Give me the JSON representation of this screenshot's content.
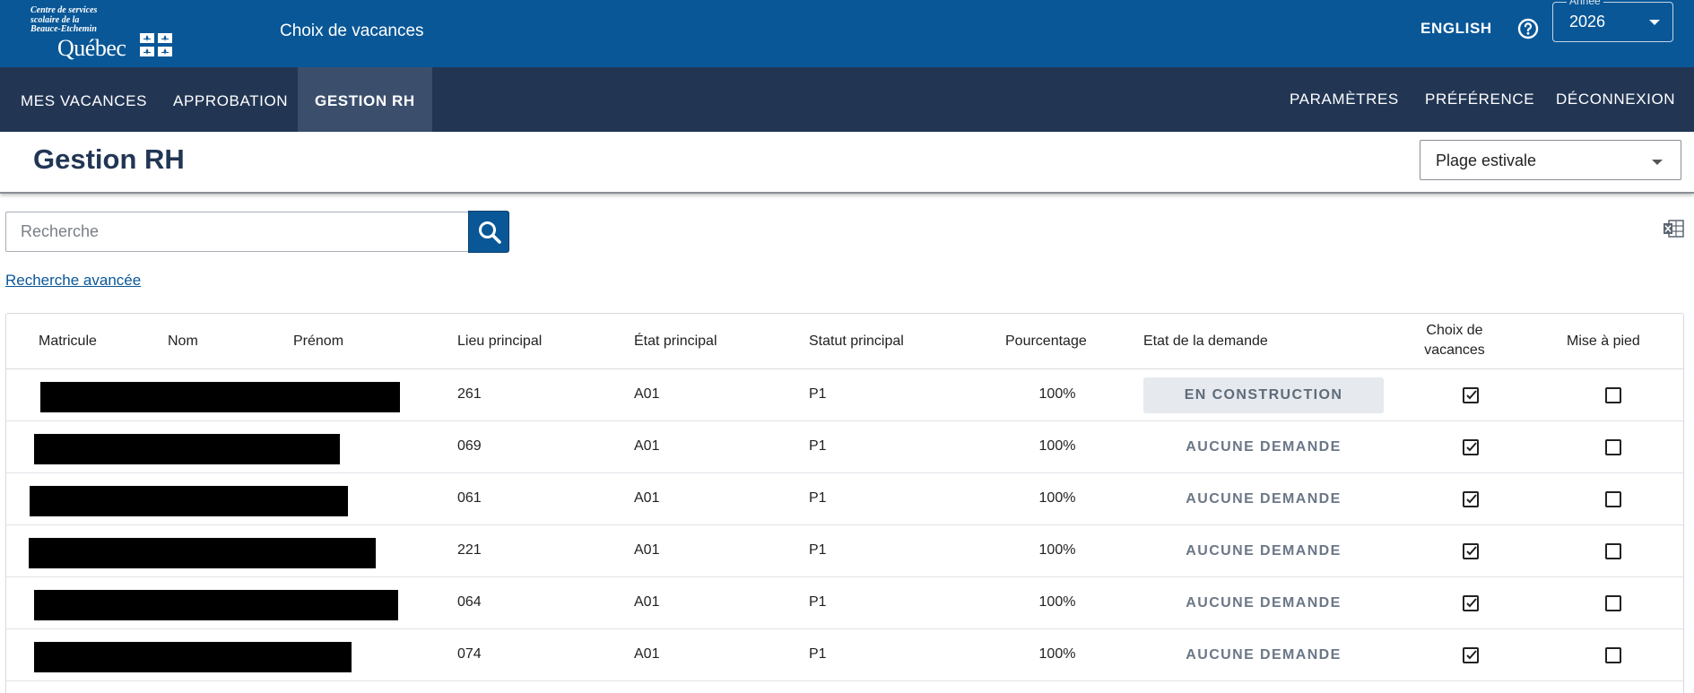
{
  "header": {
    "logo_lines": [
      "Centre de services",
      "scolaire de la",
      "Beauce-Etchemin"
    ],
    "logo_wordmark": "Québec",
    "app_title": "Choix de vacances",
    "language_link": "ENGLISH",
    "year_label": "Année",
    "year_value": "2026"
  },
  "nav": {
    "left": [
      "MES VACANCES",
      "APPROBATION",
      "GESTION RH"
    ],
    "active": "GESTION RH",
    "right": [
      "PARAMÈTRES",
      "PRÉFÉRENCE",
      "DÉCONNEXION"
    ]
  },
  "page": {
    "title": "Gestion RH",
    "period_value": "Plage estivale"
  },
  "search": {
    "placeholder": "Recherche",
    "advanced_link": "Recherche avancée"
  },
  "table": {
    "columns": [
      "Matricule",
      "Nom",
      "Prénom",
      "Lieu principal",
      "État principal",
      "Statut principal",
      "Pourcentage",
      "Etat de la demande",
      "Choix de vacances",
      "Mise à pied"
    ],
    "rows": [
      {
        "lieu": "261",
        "etat": "A01",
        "statut": "P1",
        "pourcentage": "100%",
        "demande": "EN CONSTRUCTION",
        "choix": true,
        "mise_a_pied": false
      },
      {
        "lieu": "069",
        "etat": "A01",
        "statut": "P1",
        "pourcentage": "100%",
        "demande": "AUCUNE DEMANDE",
        "choix": true,
        "mise_a_pied": false
      },
      {
        "lieu": "061",
        "etat": "A01",
        "statut": "P1",
        "pourcentage": "100%",
        "demande": "AUCUNE DEMANDE",
        "choix": true,
        "mise_a_pied": false
      },
      {
        "lieu": "221",
        "etat": "A01",
        "statut": "P1",
        "pourcentage": "100%",
        "demande": "AUCUNE DEMANDE",
        "choix": true,
        "mise_a_pied": false
      },
      {
        "lieu": "064",
        "etat": "A01",
        "statut": "P1",
        "pourcentage": "100%",
        "demande": "AUCUNE DEMANDE",
        "choix": true,
        "mise_a_pied": false
      },
      {
        "lieu": "074",
        "etat": "A01",
        "statut": "P1",
        "pourcentage": "100%",
        "demande": "AUCUNE DEMANDE",
        "choix": true,
        "mise_a_pied": false
      }
    ]
  },
  "colors": {
    "header_blue": "#095797",
    "nav_navy": "#223654",
    "nav_active": "#3b4f6d",
    "title_text": "#223654"
  },
  "icons": {
    "help": "help-circle-icon",
    "search": "magnifier-icon",
    "export": "excel-export-icon",
    "checkbox_checked": "checkbox-checked-icon",
    "checkbox_empty": "checkbox-empty-icon"
  }
}
